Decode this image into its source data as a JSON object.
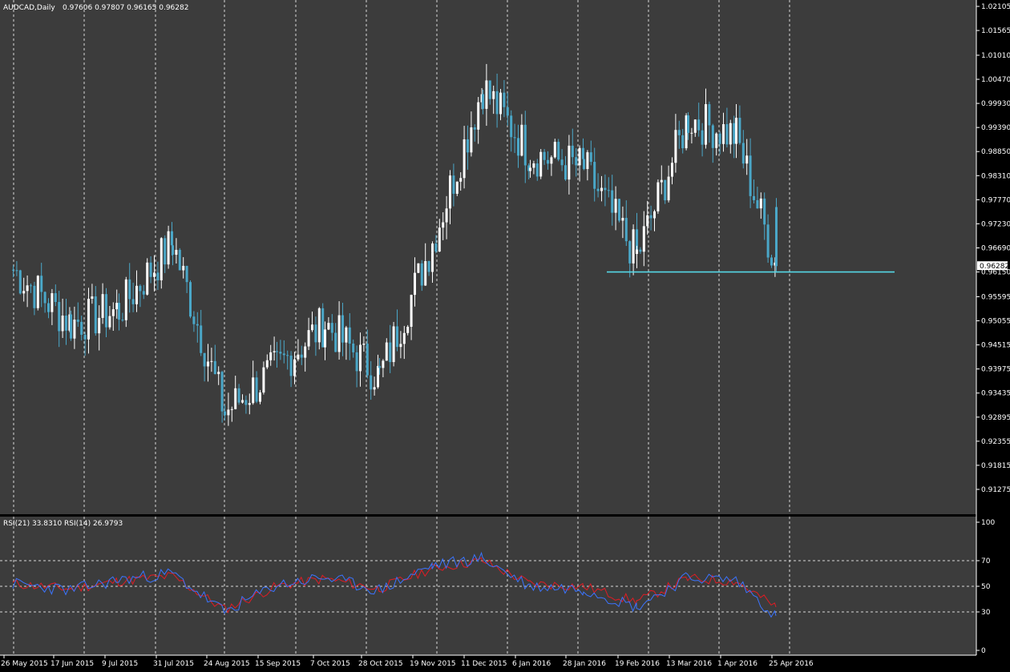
{
  "header": {
    "symbol": "AUDCAD,Daily",
    "ohlc": "0.97606 0.97807 0.96165 0.96282"
  },
  "colors": {
    "background": "#000000",
    "pane": "#3c3c3c",
    "grid": "#d9d9d9",
    "bull_candle": "#ffffff",
    "bear_candle": "#4aa7c8",
    "support_line": "#55d8e6",
    "price_box": "#ffffff",
    "rsi21": "#e01c24",
    "rsi14": "#3b74ff"
  },
  "price_axis": {
    "labels": [
      "1.02105",
      "1.01565",
      "1.01010",
      "1.00470",
      "0.99930",
      "0.99390",
      "0.98850",
      "0.98310",
      "0.97770",
      "0.97230",
      "0.96690",
      "0.96150",
      "0.95595",
      "0.95055",
      "0.94515",
      "0.93975",
      "0.93435",
      "0.92895",
      "0.92355",
      "0.91815",
      "0.91275"
    ],
    "current_price": "0.96282"
  },
  "date_axis": {
    "labels": [
      "26 May 2015",
      "17 Jun 2015",
      "9 Jul 2015",
      "31 Jul 2015",
      "24 Aug 2015",
      "15 Sep 2015",
      "7 Oct 2015",
      "28 Oct 2015",
      "19 Nov 2015",
      "11 Dec 2015",
      "6 Jan 2016",
      "28 Jan 2016",
      "19 Feb 2016",
      "13 Mar 2016",
      "1 Apr 2016",
      "25 Apr 2016"
    ]
  },
  "rsi_panel": {
    "title": "RSI(21) 33.8310  RSI(14) 26.9793",
    "axis_labels": [
      "100",
      "70",
      "50",
      "30",
      "0"
    ],
    "levels": [
      70,
      50,
      30
    ]
  },
  "chart_data": {
    "type": "candlestick",
    "symbol": "AUDCAD",
    "timeframe": "Daily",
    "last_bar": {
      "open": 0.97606,
      "high": 0.97807,
      "low": 0.96165,
      "close": 0.96282
    },
    "ylim": [
      0.91,
      1.022
    ],
    "grid": true,
    "support_line": {
      "price": 0.9615,
      "from": "19 Feb 2016",
      "to": "after 25 Apr 2016"
    },
    "anchors": [
      {
        "date": "26 May 2015",
        "close": 0.962
      },
      {
        "date": "17 Jun 2015",
        "close": 0.95
      },
      {
        "date": "9 Jul 2015",
        "close": 0.953
      },
      {
        "date": "31 Jul 2015",
        "close": 0.968
      },
      {
        "date": "24 Aug 2015",
        "close": 0.93
      },
      {
        "date": "15 Sep 2015",
        "close": 0.94
      },
      {
        "date": "7 Oct 2015",
        "close": 0.95
      },
      {
        "date": "28 Oct 2015",
        "close": 0.938
      },
      {
        "date": "19 Nov 2015",
        "close": 0.968
      },
      {
        "date": "11 Dec 2015",
        "close": 1.003
      },
      {
        "date": "6 Jan 2016",
        "close": 0.988
      },
      {
        "date": "28 Jan 2016",
        "close": 0.985
      },
      {
        "date": "19 Feb 2016",
        "close": 0.965
      },
      {
        "date": "13 Mar 2016",
        "close": 0.996
      },
      {
        "date": "1 Apr 2016",
        "close": 0.992
      },
      {
        "date": "25 Apr 2016",
        "close": 0.96282
      }
    ],
    "rsi_series": [
      {
        "name": "RSI(21)",
        "last": 33.831
      },
      {
        "name": "RSI(14)",
        "last": 26.9793
      }
    ],
    "rsi_anchors": [
      {
        "date": "26 May 2015",
        "rsi21": 52,
        "rsi14": 52
      },
      {
        "date": "17 Jun 2015",
        "rsi21": 48,
        "rsi14": 47
      },
      {
        "date": "9 Jul 2015",
        "rsi21": 54,
        "rsi14": 55
      },
      {
        "date": "31 Jul 2015",
        "rsi21": 58,
        "rsi14": 60
      },
      {
        "date": "24 Aug 2015",
        "rsi21": 32,
        "rsi14": 30
      },
      {
        "date": "15 Sep 2015",
        "rsi21": 50,
        "rsi14": 51
      },
      {
        "date": "7 Oct 2015",
        "rsi21": 56,
        "rsi14": 57
      },
      {
        "date": "28 Oct 2015",
        "rsi21": 48,
        "rsi14": 47
      },
      {
        "date": "19 Nov 2015",
        "rsi21": 64,
        "rsi14": 66
      },
      {
        "date": "11 Dec 2015",
        "rsi21": 70,
        "rsi14": 72
      },
      {
        "date": "6 Jan 2016",
        "rsi21": 52,
        "rsi14": 50
      },
      {
        "date": "28 Jan 2016",
        "rsi21": 50,
        "rsi14": 48
      },
      {
        "date": "19 Feb 2016",
        "rsi21": 38,
        "rsi14": 34
      },
      {
        "date": "13 Mar 2016",
        "rsi21": 56,
        "rsi14": 57
      },
      {
        "date": "1 Apr 2016",
        "rsi21": 54,
        "rsi14": 55
      },
      {
        "date": "25 Apr 2016",
        "rsi21": 33.831,
        "rsi14": 26.9793
      }
    ]
  }
}
